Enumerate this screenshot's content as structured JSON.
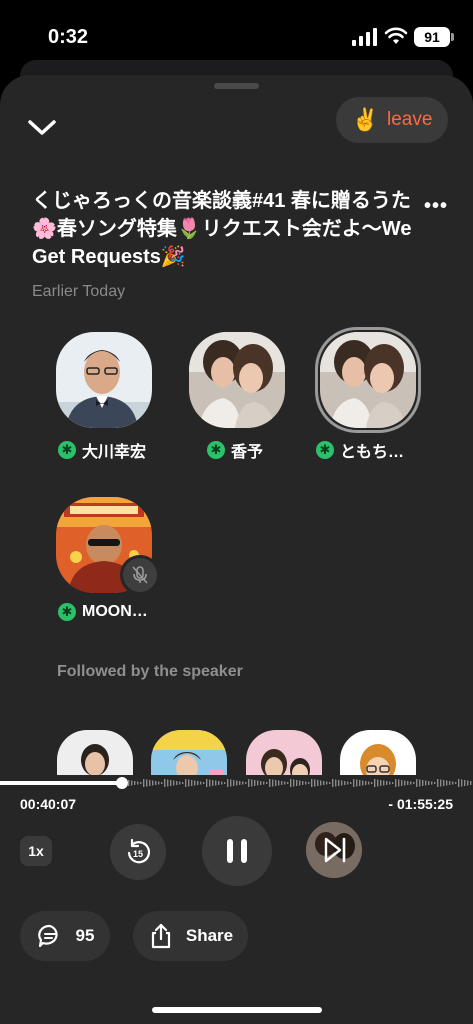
{
  "status_bar": {
    "time": "0:32",
    "battery": "91",
    "icons": [
      "signal-icon",
      "wifi-icon",
      "battery-icon"
    ]
  },
  "header": {
    "leave_emoji": "✌️",
    "leave_label": "leave",
    "leave_color": "#ff6a3d"
  },
  "room": {
    "title": "くじゃろっくの音楽談義#41 春に贈るうた🌸春ソング特集🌷リクエスト会だよ〜We Get Requests🎉",
    "subtitle": "Earlier Today"
  },
  "speakers": [
    {
      "name": "大川幸宏",
      "avatar": "man-portrait"
    },
    {
      "name": "香予",
      "avatar": "two-women-portrait"
    },
    {
      "name": "ともち…",
      "avatar": "two-women-portrait",
      "speaking": true
    },
    {
      "name": "MOON…",
      "avatar": "sunglasses-poster",
      "muted": true
    }
  ],
  "followed_section": {
    "label": "Followed by the speaker"
  },
  "player": {
    "elapsed": "00:40:07",
    "remaining": "- 01:55:25",
    "progress": 0.258,
    "speed": "1x",
    "rewind_seconds": "15"
  },
  "actions": {
    "comments_count": "95",
    "share_label": "Share"
  },
  "colors": {
    "accent_green": "#2bc16a",
    "sheet_bg": "#262626"
  }
}
